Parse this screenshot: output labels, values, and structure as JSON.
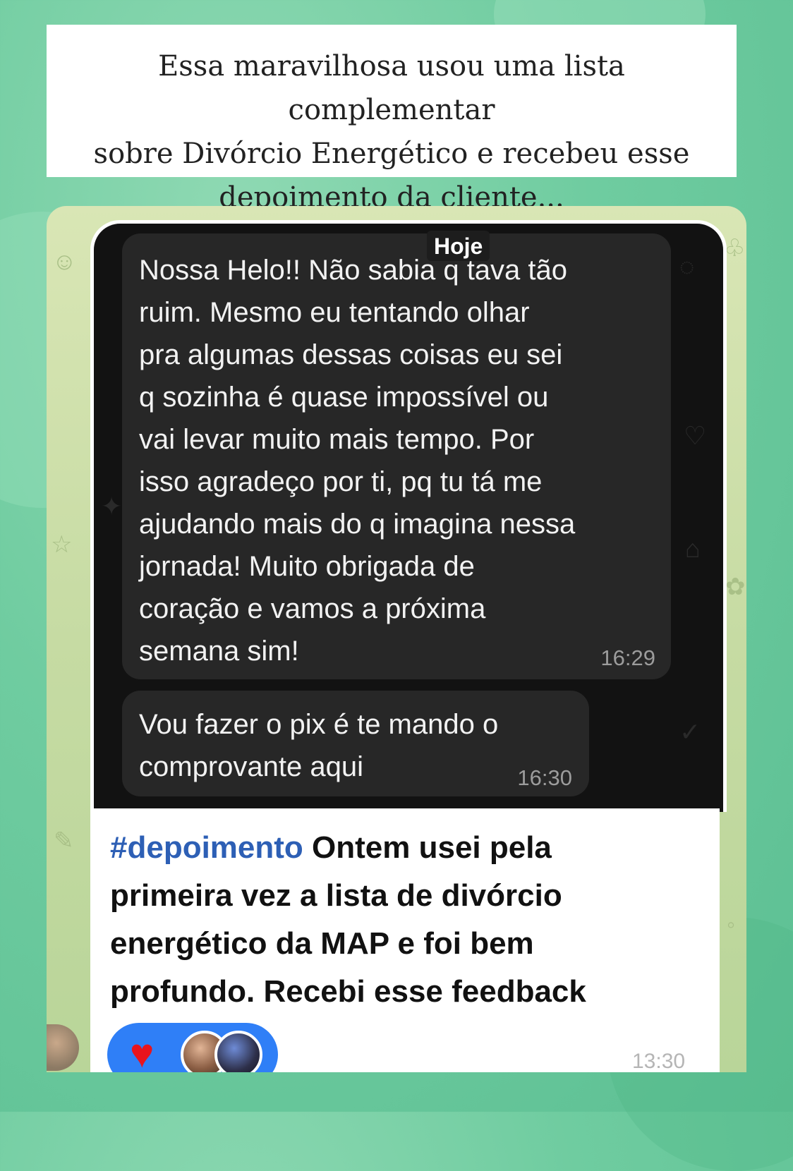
{
  "caption": {
    "lines": [
      "Essa maravilhosa usou uma lista complementar",
      "sobre Divórcio Energético e recebeu esse",
      "depoimento da cliente..."
    ]
  },
  "chat": {
    "date_label": "Hoje",
    "messages": [
      {
        "lines": [
          "Nossa Helo!! Não sabia q tava tão",
          "ruim. Mesmo eu tentando olhar",
          "pra algumas dessas coisas eu sei",
          "q sozinha é quase impossível ou",
          "vai levar muito mais tempo. Por",
          "isso agradeço por ti, pq tu tá me",
          "ajudando mais do q imagina nessa",
          "jornada! Muito obrigada de",
          "coração e vamos a próxima",
          "semana sim!"
        ],
        "time": "16:29"
      },
      {
        "lines": [
          "Vou fazer o pix é te mando o",
          "comprovante aqui"
        ],
        "time": "16:30"
      }
    ]
  },
  "comment": {
    "hashtag": "#depoimento",
    "line1_rest": " Ontem usei pela",
    "lines": [
      "primeira vez a lista de divórcio",
      "energético da MAP e foi bem",
      "profundo. Recebi esse feedback"
    ],
    "reaction_icon": "heart-icon",
    "time": "13:30"
  },
  "colors": {
    "background": "#6fcca0",
    "hashtag": "#2d5fb5",
    "reaction_pill": "#2f7ff7",
    "heart": "#e8141d",
    "bubble": "#272727"
  }
}
